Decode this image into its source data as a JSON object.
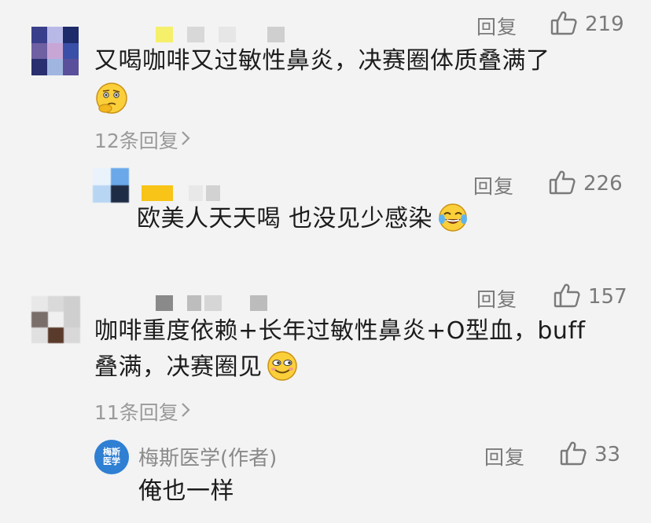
{
  "comments": [
    {
      "text": "又喝咖啡又过敏性鼻炎，决赛圈体质叠满了",
      "reply_label": "回复",
      "likes": "219",
      "replies_summary": "12条回复",
      "emoji": "thinking-face-emoji",
      "reply": {
        "text": "欧美人天天喝 也没见少感染",
        "reply_label": "回复",
        "likes": "226",
        "emoji": "tears-of-joy-emoji"
      }
    },
    {
      "text_line1": "咖啡重度依赖+长年过敏性鼻炎+O型血，buff",
      "text_line2": "叠满，决赛圈见",
      "reply_label": "回复",
      "likes": "157",
      "replies_summary": "11条回复",
      "emoji": "smirking-grin-emoji",
      "reply": {
        "author": "梅斯医学(作者)",
        "avatar_text_line1": "梅斯",
        "avatar_text_line2": "医学",
        "text": "俺也一样",
        "reply_label": "回复",
        "likes": "33"
      }
    }
  ],
  "colors": {
    "background": "#f3f3f3",
    "meta_text": "#7a7a7a",
    "body_text": "#1c1c1c",
    "author_avatar_blue": "#2f7fd3"
  }
}
